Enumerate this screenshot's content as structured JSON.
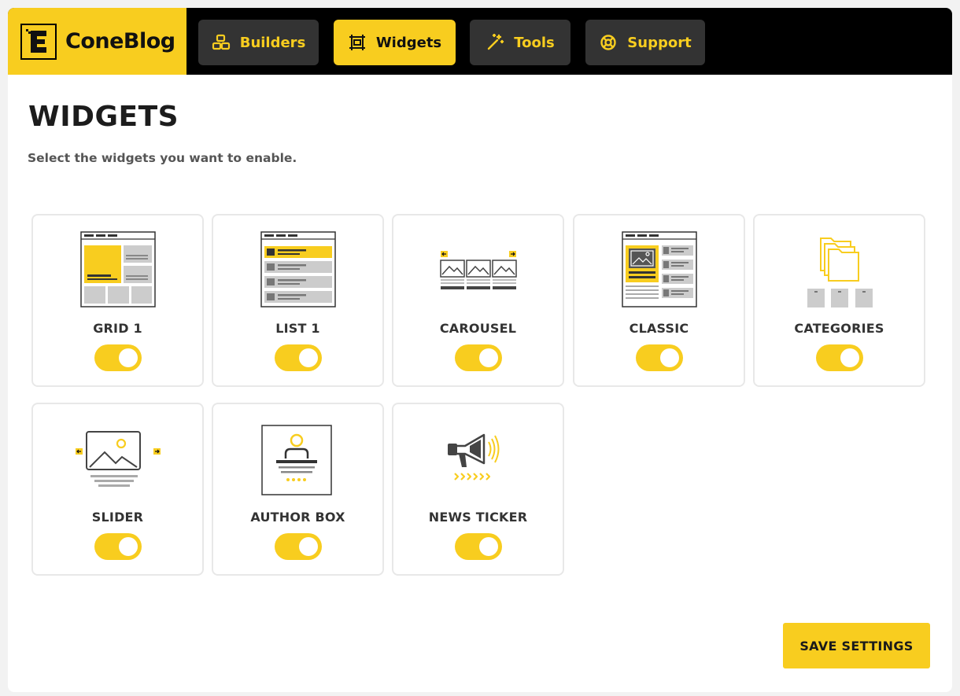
{
  "brand": {
    "name": "ConeBlog"
  },
  "nav": {
    "tabs": [
      {
        "label": "Builders",
        "icon": "blocks-icon",
        "active": false
      },
      {
        "label": "Widgets",
        "icon": "widget-frame-icon",
        "active": true
      },
      {
        "label": "Tools",
        "icon": "magic-wand-icon",
        "active": false
      },
      {
        "label": "Support",
        "icon": "lifebuoy-icon",
        "active": false
      }
    ]
  },
  "page": {
    "title": "WIDGETS",
    "subtitle": "Select the widgets you want to enable."
  },
  "widgets": [
    {
      "label": "GRID 1",
      "icon": "grid-layout-icon",
      "enabled": true
    },
    {
      "label": "LIST 1",
      "icon": "list-layout-icon",
      "enabled": true
    },
    {
      "label": "CAROUSEL",
      "icon": "carousel-icon",
      "enabled": true
    },
    {
      "label": "CLASSIC",
      "icon": "classic-layout-icon",
      "enabled": true
    },
    {
      "label": "CATEGORIES",
      "icon": "categories-folder-icon",
      "enabled": true
    },
    {
      "label": "SLIDER",
      "icon": "slider-image-icon",
      "enabled": true
    },
    {
      "label": "AUTHOR BOX",
      "icon": "author-box-icon",
      "enabled": true
    },
    {
      "label": "NEWS TICKER",
      "icon": "megaphone-icon",
      "enabled": true
    }
  ],
  "actions": {
    "save_label": "SAVE SETTINGS"
  },
  "colors": {
    "accent": "#f8cd1f",
    "dark": "#000000",
    "tab_bg": "#333333"
  }
}
